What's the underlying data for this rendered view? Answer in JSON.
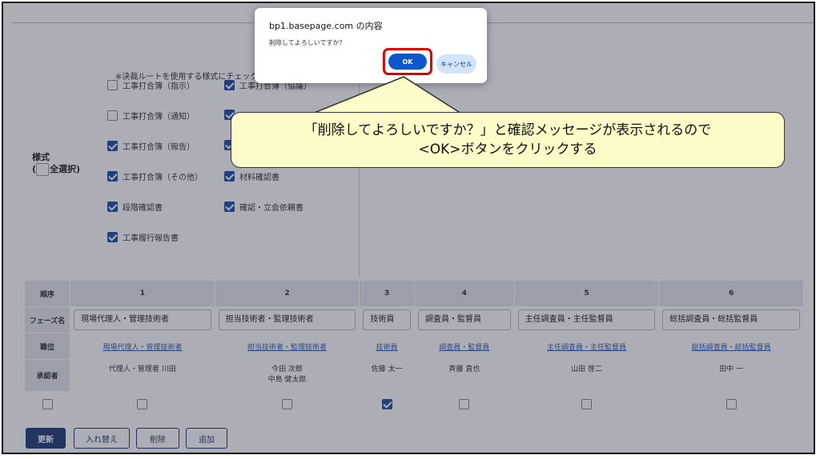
{
  "dialog": {
    "title": "bp1.basepage.com の内容",
    "message": "削除してよろしいですか？",
    "ok_label": "OK",
    "cancel_label": "キャンセル"
  },
  "callout": {
    "line1": "「削除してよろしいですか？」と確認メッセージが表示されるので",
    "line2": "<OK>ボタンをクリックする"
  },
  "form": {
    "note": "※決裁ルートを使用する様式にチェック",
    "section_label": "様式",
    "select_all": "全選択)",
    "select_all_prefix": "(",
    "items": [
      {
        "label": "工事打合簿（指示）",
        "checked": false
      },
      {
        "label": "工事打合簿（協議）",
        "checked": true
      },
      {
        "label": "工事打合簿（通知）",
        "checked": false
      },
      {
        "label": "",
        "checked": true
      },
      {
        "label": "工事打合簿（報告）",
        "checked": true
      },
      {
        "label": "",
        "checked": true
      },
      {
        "label": "工事打合簿（その他）",
        "checked": true
      },
      {
        "label": "材料確認書",
        "checked": true
      },
      {
        "label": "段階確認書",
        "checked": true
      },
      {
        "label": "確認・立会依頼書",
        "checked": true
      },
      {
        "label": "工事履行報告書",
        "checked": true
      }
    ]
  },
  "table": {
    "row_headers": [
      "順序",
      "フェーズ名",
      "職位",
      "承認者"
    ],
    "columns": [
      {
        "order": "1",
        "phase": "現場代理人・管理技術者",
        "position": "現場代理人・管理技術者",
        "approvers": [
          "代理人・管理者 川田"
        ],
        "checked": false
      },
      {
        "order": "2",
        "phase": "担当技術者・監理技術者",
        "position": "担当技術者・監理技術者",
        "approvers": [
          "今田 次郎",
          "中島 健太郎"
        ],
        "checked": false
      },
      {
        "order": "3",
        "phase": "技術員",
        "position": "技術員",
        "approvers": [
          "佐藤 太一"
        ],
        "checked": true
      },
      {
        "order": "4",
        "phase": "調査員・監督員",
        "position": "調査員・監督員",
        "approvers": [
          "斉藤 直也"
        ],
        "checked": false
      },
      {
        "order": "5",
        "phase": "主任調査員・主任監督員",
        "position": "主任調査員・主任監督員",
        "approvers": [
          "山田 啓二"
        ],
        "checked": false
      },
      {
        "order": "6",
        "phase": "総括調査員・総括監督員",
        "position": "総括調査員・総括監督員",
        "approvers": [
          "田中 一"
        ],
        "checked": false
      }
    ]
  },
  "actions": {
    "update": "更新",
    "swap": "入れ替え",
    "delete": "削除",
    "add": "追加"
  },
  "colors": {
    "accent": "#1f3e7a",
    "dialog_ok": "#0b57d0",
    "highlight": "#e00000",
    "callout_bg": "#fdfbc8"
  }
}
